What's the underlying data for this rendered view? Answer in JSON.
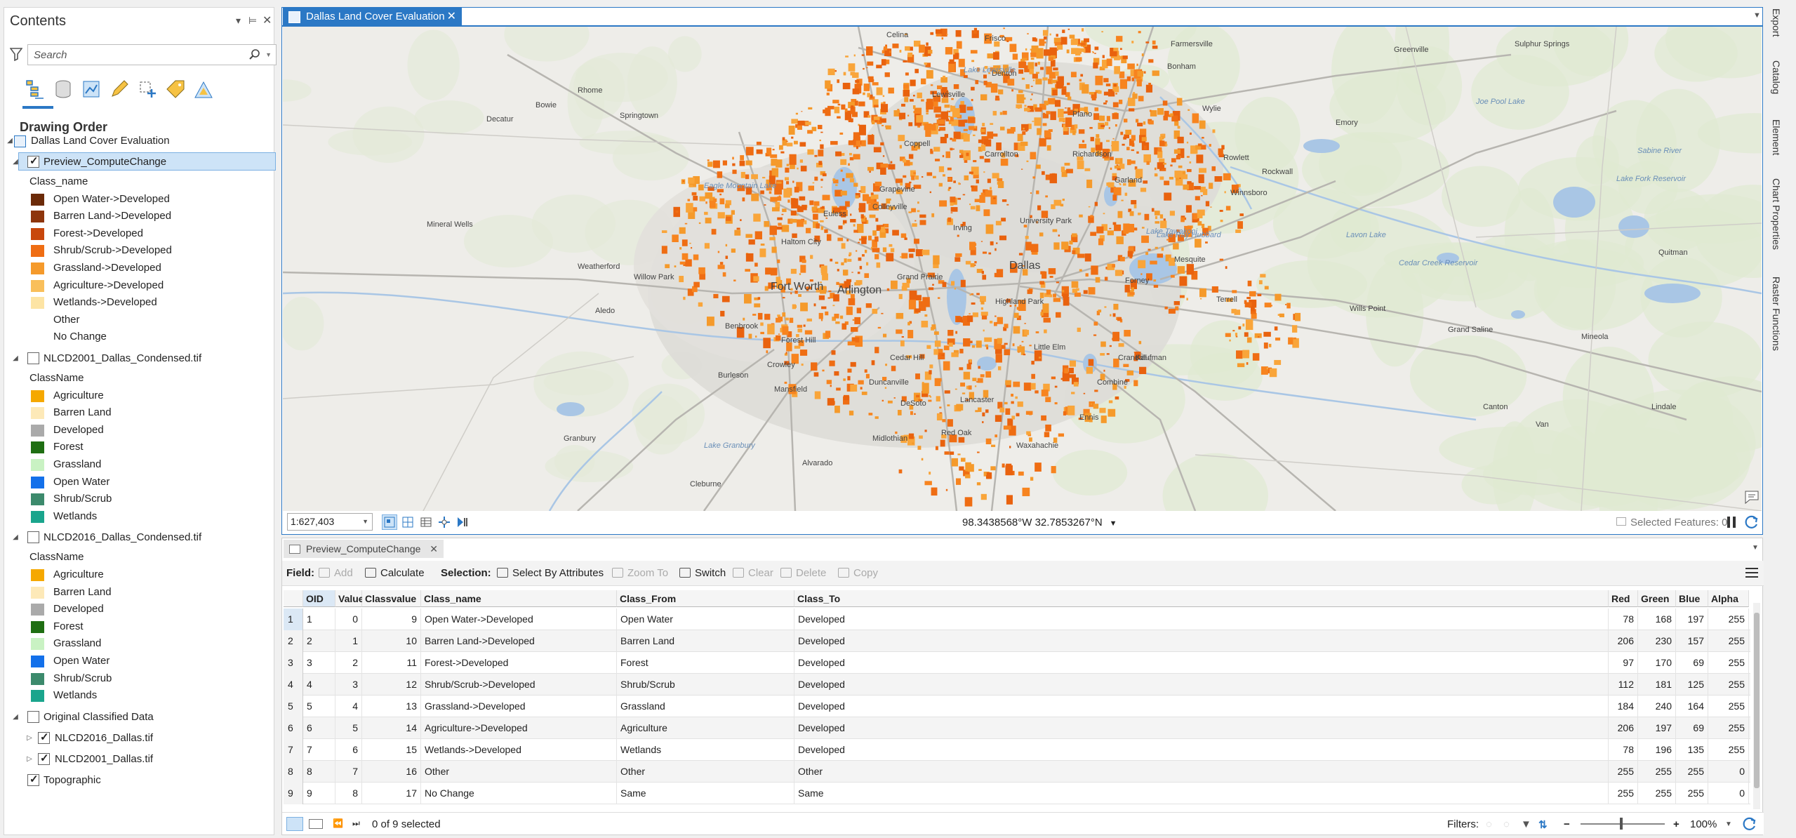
{
  "contents": {
    "title": "Contents",
    "search_placeholder": "Search",
    "drawing_order": "Drawing Order",
    "map_name": "Dallas Land Cover Evaluation",
    "layers": [
      {
        "name": "Preview_ComputeChange",
        "checked": true,
        "field": "Class_name",
        "items": [
          {
            "label": "Open Water->Developed",
            "color": "#6b2a08"
          },
          {
            "label": "Barren Land->Developed",
            "color": "#8e350c"
          },
          {
            "label": "Forest->Developed",
            "color": "#c8470c"
          },
          {
            "label": "Shrub/Scrub->Developed",
            "color": "#ef6d13"
          },
          {
            "label": "Grassland->Developed",
            "color": "#f59a2b"
          },
          {
            "label": "Agriculture->Developed",
            "color": "#f9bf5b"
          },
          {
            "label": "Wetlands->Developed",
            "color": "#fde4a4"
          },
          {
            "label": "Other",
            "color": ""
          },
          {
            "label": "No Change",
            "color": ""
          }
        ]
      },
      {
        "name": "NLCD2001_Dallas_Condensed.tif",
        "checked": false,
        "field": "ClassName",
        "items": [
          {
            "label": "Agriculture",
            "color": "#f5a800"
          },
          {
            "label": "Barren Land",
            "color": "#fde9b8"
          },
          {
            "label": "Developed",
            "color": "#aaaaaa"
          },
          {
            "label": "Forest",
            "color": "#1f6e12"
          },
          {
            "label": "Grassland",
            "color": "#c9f2c3"
          },
          {
            "label": "Open Water",
            "color": "#1370ea"
          },
          {
            "label": "Shrub/Scrub",
            "color": "#3c8a6c"
          },
          {
            "label": "Wetlands",
            "color": "#1aa58d"
          }
        ]
      },
      {
        "name": "NLCD2016_Dallas_Condensed.tif",
        "checked": false,
        "field": "ClassName",
        "items": [
          {
            "label": "Agriculture",
            "color": "#f5a800"
          },
          {
            "label": "Barren Land",
            "color": "#fde9b8"
          },
          {
            "label": "Developed",
            "color": "#aaaaaa"
          },
          {
            "label": "Forest",
            "color": "#1f6e12"
          },
          {
            "label": "Grassland",
            "color": "#c9f2c3"
          },
          {
            "label": "Open Water",
            "color": "#1370ea"
          },
          {
            "label": "Shrub/Scrub",
            "color": "#3c8a6c"
          },
          {
            "label": "Wetlands",
            "color": "#1aa58d"
          }
        ]
      }
    ],
    "group": {
      "name": "Original Classified Data",
      "checked": false,
      "children": [
        {
          "name": "NLCD2016_Dallas.tif",
          "checked": true
        },
        {
          "name": "NLCD2001_Dallas.tif",
          "checked": true
        }
      ]
    },
    "basemap": {
      "name": "Topographic",
      "checked": true
    }
  },
  "map": {
    "tab_title": "Dallas Land Cover Evaluation",
    "scale": "1:627,403",
    "coordinates": "98.3438568°W 32.7853267°N",
    "selected_features": "Selected Features: 0",
    "labels": [
      "Farmersville",
      "Greenville",
      "Sulphur Springs",
      "Frisco",
      "Celina",
      "Lewisville",
      "Plano",
      "Carrollton",
      "Richardson",
      "Garland",
      "Rowlett",
      "Rockwall",
      "Wylie",
      "Coppell",
      "Grapevine",
      "Colleyville",
      "Euless",
      "Irving",
      "Haltom City",
      "Fort Worth",
      "Arlington",
      "Grand Prairie",
      "Dallas",
      "Mesquite",
      "Weatherford",
      "Willow Park",
      "Aledo",
      "Benbrook",
      "Forest Hill",
      "Mansfield",
      "Duncanville",
      "DeSoto",
      "Lancaster",
      "Cedar Hill",
      "Midlothian",
      "Red Oak",
      "Ennis",
      "Waxahachie",
      "Crandall",
      "Forney",
      "Terrell",
      "Kaufman",
      "Combine",
      "Wills Point",
      "Grand Saline",
      "Canton",
      "Van",
      "Mineola",
      "Quitman",
      "Lindale",
      "Burleson",
      "Crowley",
      "Alvarado",
      "Cleburne",
      "Granbury",
      "Mineral Wells",
      "Springtown",
      "Rhome",
      "Bowie",
      "Decatur",
      "Denton",
      "Little Elm",
      "Highland Park",
      "University Park",
      "Lake Tawakoni",
      "Lake Lewisville",
      "Lake Ray Hubbard",
      "Eagle Mountain Lake",
      "Lake Fork Reservoir",
      "Cedar Creek Reservoir",
      "Lake Granbury",
      "Joe Pool Lake",
      "Lavon Lake",
      "Sabine River",
      "Winnsboro",
      "Emory",
      "Bonham"
    ]
  },
  "side_tabs": [
    "Export",
    "Catalog",
    "Element",
    "Chart Properties",
    "Raster Functions"
  ],
  "table": {
    "tab_title": "Preview_ComputeChange",
    "toolbar": {
      "field": "Field:",
      "add": "Add",
      "calculate": "Calculate",
      "selection": "Selection:",
      "select_by_attributes": "Select By Attributes",
      "zoom_to": "Zoom To",
      "switch": "Switch",
      "clear": "Clear",
      "delete": "Delete",
      "copy": "Copy"
    },
    "columns": [
      "OID",
      "Value",
      "Classvalue",
      "Class_name",
      "Class_From",
      "Class_To",
      "Red",
      "Green",
      "Blue",
      "Alpha"
    ],
    "rows": [
      [
        "1",
        "0",
        "9",
        "Open Water->Developed",
        "Open Water",
        "Developed",
        "78",
        "168",
        "197",
        "255"
      ],
      [
        "2",
        "1",
        "10",
        "Barren Land->Developed",
        "Barren Land",
        "Developed",
        "206",
        "230",
        "157",
        "255"
      ],
      [
        "3",
        "2",
        "11",
        "Forest->Developed",
        "Forest",
        "Developed",
        "97",
        "170",
        "69",
        "255"
      ],
      [
        "4",
        "3",
        "12",
        "Shrub/Scrub->Developed",
        "Shrub/Scrub",
        "Developed",
        "112",
        "181",
        "125",
        "255"
      ],
      [
        "5",
        "4",
        "13",
        "Grassland->Developed",
        "Grassland",
        "Developed",
        "184",
        "240",
        "164",
        "255"
      ],
      [
        "6",
        "5",
        "14",
        "Agriculture->Developed",
        "Agriculture",
        "Developed",
        "206",
        "197",
        "69",
        "255"
      ],
      [
        "7",
        "6",
        "15",
        "Wetlands->Developed",
        "Wetlands",
        "Developed",
        "78",
        "196",
        "135",
        "255"
      ],
      [
        "8",
        "7",
        "16",
        "Other",
        "Other",
        "Other",
        "255",
        "255",
        "255",
        "0"
      ],
      [
        "9",
        "8",
        "17",
        "No Change",
        "Same",
        "Same",
        "255",
        "255",
        "255",
        "0"
      ]
    ],
    "status": "0 of 9 selected",
    "filters": "Filters:",
    "zoom": "100%"
  },
  "colors": {
    "accent": "#2b78c5",
    "change": "#f7841f",
    "selection": "#cde3f7"
  }
}
